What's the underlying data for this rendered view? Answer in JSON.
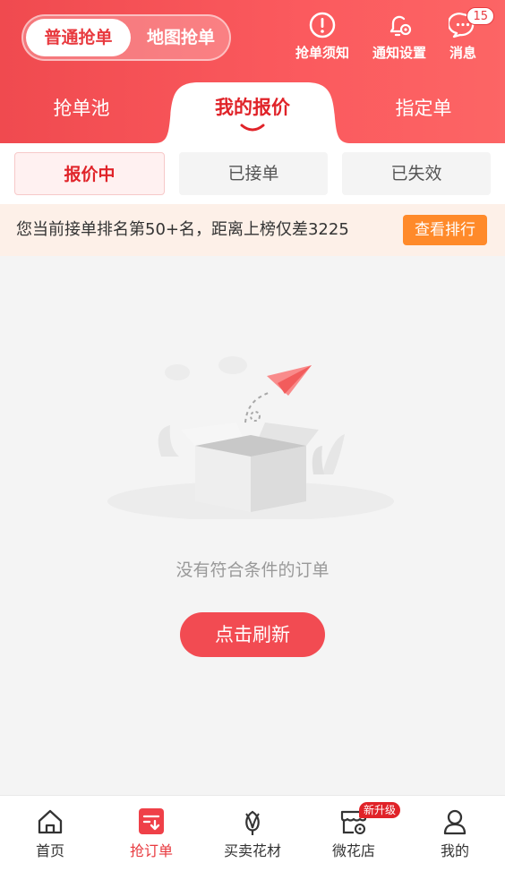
{
  "header": {
    "mode_segment": {
      "active": "普通抢单",
      "inactive": "地图抢单"
    },
    "actions": [
      {
        "label": "抢单须知",
        "icon": "alert-circle-icon"
      },
      {
        "label": "通知设置",
        "icon": "bell-settings-icon"
      },
      {
        "label": "消息",
        "icon": "chat-bubble-icon",
        "badge": "15"
      }
    ]
  },
  "main_tabs": {
    "left": "抢单池",
    "active": "我的报价",
    "right": "指定单"
  },
  "sub_tabs": {
    "active": "报价中",
    "second": "已接单",
    "third": "已失效"
  },
  "rank_bar": {
    "text": "您当前接单排名第50+名，距离上榜仅差3225",
    "button": "查看排行"
  },
  "empty": {
    "message": "没有符合条件的订单",
    "button": "点击刷新"
  },
  "bottom_nav": {
    "items": [
      {
        "label": "首页",
        "icon": "home-icon"
      },
      {
        "label": "抢订单",
        "icon": "grab-order-icon"
      },
      {
        "label": "买卖花材",
        "icon": "flower-icon"
      },
      {
        "label": "微花店",
        "icon": "shop-icon",
        "badge": "新升级"
      },
      {
        "label": "我的",
        "icon": "profile-icon"
      }
    ]
  },
  "colors": {
    "brand_red": "#f04a4f",
    "accent_orange": "#ff8a2a",
    "active_text": "#e02329"
  }
}
